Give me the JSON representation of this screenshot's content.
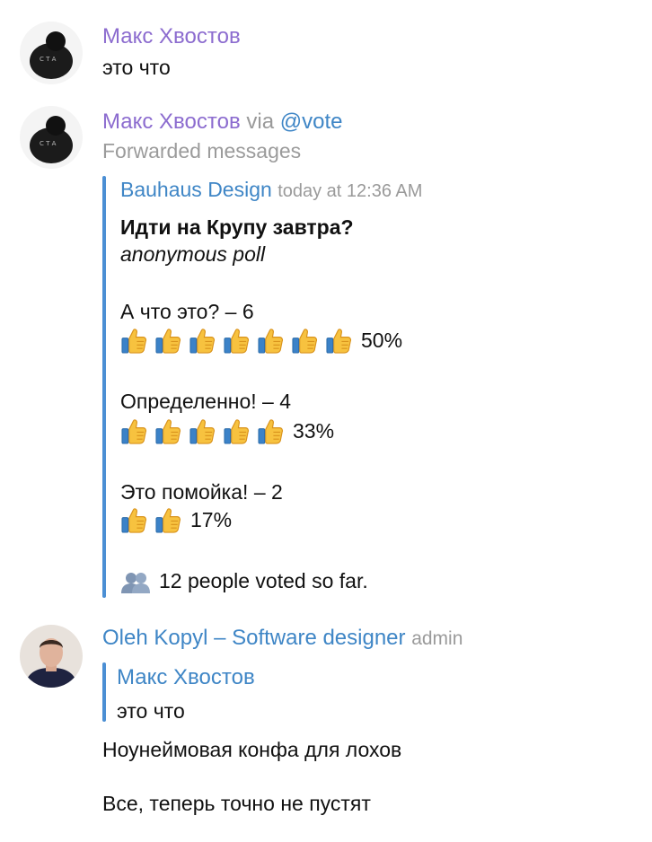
{
  "messages": [
    {
      "author": "Макс Хвостов",
      "text": "это что"
    },
    {
      "author": "Макс Хвостов",
      "via_word": "via",
      "via_bot": "@vote",
      "forwarded_label": "Forwarded messages",
      "forward": {
        "source": "Bauhaus Design",
        "time": "today at 12:36 AM",
        "poll": {
          "question": "Идти на Крупу завтра?",
          "type": "anonymous poll",
          "options": [
            {
              "label": "А что это? – 6",
              "thumbs": 7,
              "percent": "50%"
            },
            {
              "label": "Определенно! – 4",
              "thumbs": 5,
              "percent": "33%"
            },
            {
              "label": "Это помойка! – 2",
              "thumbs": 2,
              "percent": "17%"
            }
          ],
          "voters": "12 people voted so far.",
          "voters_icon": "people-icon"
        }
      }
    },
    {
      "author": "Oleh Kopyl – Software designer",
      "role": "admin",
      "reply": {
        "author": "Макс Хвостов",
        "text": "это что"
      },
      "lines": [
        "Ноунеймовая конфа для лохов",
        "Все, теперь точно не пустят"
      ]
    }
  ],
  "colors": {
    "purple_name": "#8c6ccf",
    "blue_name": "#3f86c6",
    "quote_bar": "#4b8fd4",
    "secondary_text": "#9b9b9b"
  }
}
